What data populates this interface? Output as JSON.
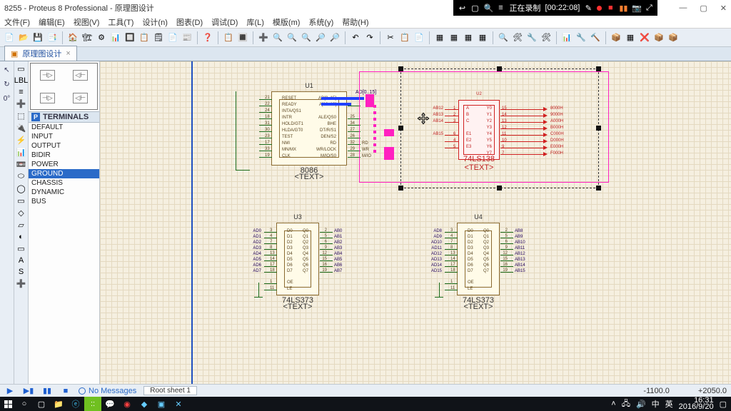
{
  "title": "8255 - Proteus 8 Professional - 原理图设计",
  "recording": {
    "label": "正在录制",
    "time": "[00:22:08]"
  },
  "menus": [
    "文件(F)",
    "编辑(E)",
    "视图(V)",
    "工具(T)",
    "设计(n)",
    "图表(D)",
    "调试(D)",
    "库(L)",
    "模版(m)",
    "系统(y)",
    "帮助(H)"
  ],
  "tab": {
    "label": "原理图设计",
    "close": "×"
  },
  "panel": {
    "header": "TERMINALS",
    "items": [
      "DEFAULT",
      "INPUT",
      "OUTPUT",
      "BIDIR",
      "POWER",
      "GROUND",
      "CHASSIS",
      "DYNAMIC",
      "BUS"
    ],
    "selected": 5
  },
  "chips": {
    "u1": {
      "name": "U1",
      "part": "8086",
      "text": "<TEXT>",
      "left": [
        "RESET",
        "READY",
        "INTA/QS1",
        "INTR",
        "HOLD/GT1",
        "HLDA/GT0",
        "TEST",
        "NMI",
        "MN/MX",
        "CLK"
      ],
      "leftnums": [
        "21",
        "22",
        "24",
        "18",
        "31",
        "30",
        "23",
        "17",
        "33",
        "19"
      ],
      "right": [
        "AD[0..15]",
        "A[16..19]",
        "",
        "ALE/QS0",
        "BHE",
        "DT/R/S1",
        "DEN/S2",
        "RD",
        "WR/LOCK",
        "M/IO/S0"
      ],
      "rightnums": [
        "",
        "",
        "",
        "25",
        "34",
        "27",
        "26",
        "32",
        "29",
        "28"
      ],
      "extraLeft": [
        "INTA"
      ],
      "extraLeftNum": [
        "24"
      ],
      "buslabel": "AD[0..15]",
      "rightout": [
        "",
        "",
        "",
        "",
        "",
        "",
        "",
        "RD",
        "WR",
        "M/IO"
      ]
    },
    "u2": {
      "name": "U2",
      "part": "74LS138",
      "text": "<TEXT>",
      "leftpins": [
        "A",
        "B",
        "C",
        "",
        "E1",
        "E2",
        "E3"
      ],
      "leftnums": [
        "1",
        "2",
        "3",
        "",
        "6",
        "4",
        "5"
      ],
      "rightpins": [
        "Y0",
        "Y1",
        "Y2",
        "Y3",
        "Y4",
        "Y5",
        "Y6",
        "Y7"
      ],
      "rightnums": [
        "15",
        "14",
        "13",
        "12",
        "11",
        "10",
        "9",
        "7"
      ],
      "leftnet": [
        "AB12",
        "AB13",
        "AB14",
        "",
        "AB15",
        "",
        ""
      ],
      "rightnet": [
        "8000H",
        "9000H",
        "A000H",
        "B000H",
        "C000H",
        "D000H",
        "E000H",
        "F000H"
      ]
    },
    "u3": {
      "name": "U3",
      "part": "74LS373",
      "text": "<TEXT>",
      "left": [
        "D0",
        "D1",
        "D2",
        "D3",
        "D4",
        "D5",
        "D6",
        "D7"
      ],
      "leftnums": [
        "3",
        "4",
        "7",
        "8",
        "13",
        "14",
        "17",
        "18"
      ],
      "right": [
        "Q0",
        "Q1",
        "Q2",
        "Q3",
        "Q4",
        "Q5",
        "Q6",
        "Q7"
      ],
      "rightnums": [
        "2",
        "5",
        "6",
        "9",
        "12",
        "15",
        "16",
        "19"
      ],
      "bottom": [
        "OE",
        "LE"
      ],
      "bottomnums": [
        "1",
        "11"
      ],
      "leftnet": [
        "AD0",
        "AD1",
        "AD2",
        "AD3",
        "AD4",
        "AD5",
        "AD6",
        "AD7"
      ],
      "rightnet": [
        "AB0",
        "AB1",
        "AB2",
        "AB3",
        "AB4",
        "AB5",
        "AB6",
        "AB7"
      ]
    },
    "u4": {
      "name": "U4",
      "part": "74LS373",
      "text": "<TEXT>",
      "left": [
        "D0",
        "D1",
        "D2",
        "D3",
        "D4",
        "D5",
        "D6",
        "D7"
      ],
      "leftnums": [
        "3",
        "4",
        "7",
        "8",
        "13",
        "14",
        "17",
        "18"
      ],
      "right": [
        "Q0",
        "Q1",
        "Q2",
        "Q3",
        "Q4",
        "Q5",
        "Q6",
        "Q7"
      ],
      "rightnums": [
        "2",
        "5",
        "6",
        "9",
        "12",
        "15",
        "16",
        "19"
      ],
      "bottom": [
        "OE",
        "LE"
      ],
      "bottomnums": [
        "1",
        "11"
      ],
      "leftnet": [
        "AD8",
        "AD9",
        "AD10",
        "AD11",
        "AD12",
        "AD13",
        "AD14",
        "AD15"
      ],
      "rightnet": [
        "AB8",
        "AB9",
        "AB10",
        "AB11",
        "AB12",
        "AB13",
        "AB14",
        "AB15"
      ]
    }
  },
  "status": {
    "messages": "No Messages",
    "sheet": "Root sheet 1",
    "x": "-1100.0",
    "y": "+2050.0"
  },
  "toolbar_icons": {
    "r1": [
      "📄",
      "📂",
      "💾",
      "📑",
      "|",
      "🏠",
      "🏗",
      "⚙",
      "📊",
      "🔲",
      "📋",
      "🗒",
      "📄",
      "📰",
      "|",
      "❓",
      "|",
      "📋",
      "🔳",
      "|",
      "➕",
      "🔍",
      "🔍",
      "🔍",
      "🔎",
      "🔎",
      "|",
      "↶",
      "↷",
      "|",
      "✂",
      "📋",
      "📄",
      "|",
      "▦",
      "▦",
      "▦",
      "▦",
      "|",
      "🔍",
      "🛠",
      "🔧",
      "🛠",
      "|",
      "📊",
      "🔧",
      "🔨",
      "|",
      "📦",
      "▦",
      "❌",
      "📦",
      "📦"
    ]
  },
  "left_tools": [
    "↖",
    "↻",
    "0°"
  ],
  "left_tools2": [
    "▭",
    "LBL",
    "≡",
    "➕",
    "⬚",
    "🔌",
    "⚡",
    "📊",
    "📼",
    "⬭",
    "◯",
    "▭",
    "◇",
    "▱",
    "◐",
    "▭",
    "A",
    "S",
    "➕"
  ],
  "clock": {
    "time": "16:31",
    "date": "2016/9/20",
    "ime1": "中",
    "ime2": "英"
  }
}
